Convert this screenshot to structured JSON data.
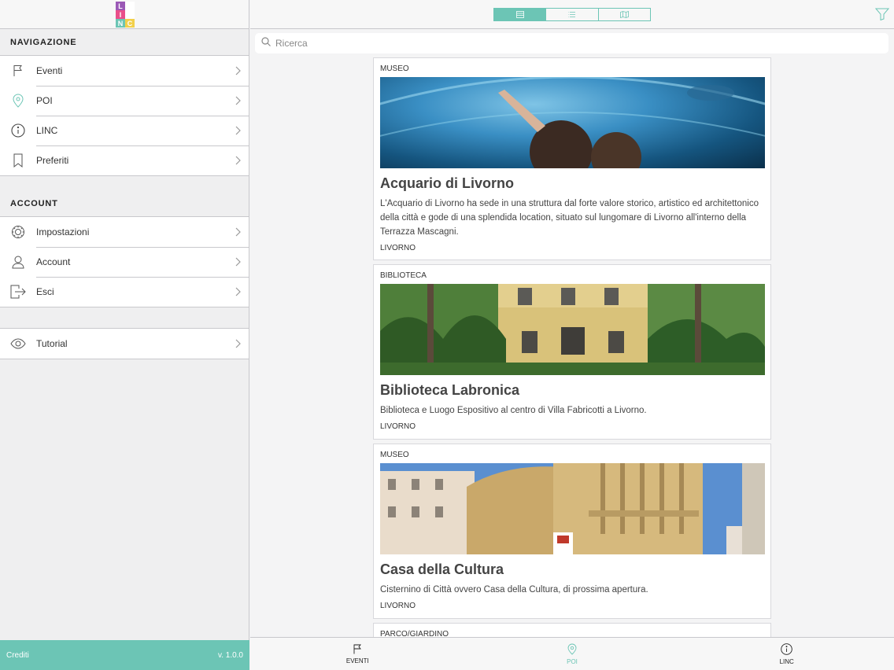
{
  "logo": {
    "letters": [
      "L",
      "I",
      "N",
      "C"
    ],
    "colors": [
      "#9b59b6",
      "#e94f8a",
      "#6cc5b5",
      "#f2d04b"
    ]
  },
  "colors": {
    "accent": "#6cc5b5"
  },
  "sidebar": {
    "nav_title": "NAVIGAZIONE",
    "nav_items": [
      {
        "label": "Eventi",
        "icon": "flag-icon"
      },
      {
        "label": "POI",
        "icon": "map-pin-icon"
      },
      {
        "label": "LINC",
        "icon": "info-icon"
      },
      {
        "label": "Preferiti",
        "icon": "bookmark-icon"
      }
    ],
    "account_title": "ACCOUNT",
    "account_items": [
      {
        "label": "Impostazioni",
        "icon": "gear-icon"
      },
      {
        "label": "Account",
        "icon": "user-icon"
      },
      {
        "label": "Esci",
        "icon": "logout-icon"
      }
    ],
    "extra_items": [
      {
        "label": "Tutorial",
        "icon": "eye-icon"
      }
    ],
    "footer": {
      "credits": "Crediti",
      "version": "v. 1.0.0"
    }
  },
  "topbar": {
    "segments": [
      "list-view-icon",
      "compact-list-icon",
      "map-view-icon"
    ],
    "active_segment": 0
  },
  "search": {
    "placeholder": "Ricerca",
    "value": ""
  },
  "cards": [
    {
      "category": "MUSEO",
      "title": "Acquario di Livorno",
      "description": "L'Acquario di Livorno ha sede in una struttura dal forte valore storico, artistico ed architettonico della città e gode di una splendida location, situato sul lungomare di Livorno all'interno della Terrazza Mascagni.",
      "city": "LIVORNO"
    },
    {
      "category": "BIBLIOTECA",
      "title": "Biblioteca Labronica",
      "description": "Biblioteca e Luogo Espositivo al centro di Villa Fabricotti a Livorno.",
      "city": "LIVORNO"
    },
    {
      "category": "MUSEO",
      "title": "Casa della Cultura",
      "description": "Cisternino di Città ovvero Casa della Cultura, di prossima apertura.",
      "city": "LIVORNO"
    },
    {
      "category": "PARCO/GIARDINO",
      "title": "",
      "description": "",
      "city": ""
    }
  ],
  "tabbar": [
    {
      "label": "EVENTI",
      "icon": "flag-icon",
      "active": false
    },
    {
      "label": "POI",
      "icon": "map-pin-icon",
      "active": true
    },
    {
      "label": "LINC",
      "icon": "info-icon",
      "active": false
    }
  ]
}
